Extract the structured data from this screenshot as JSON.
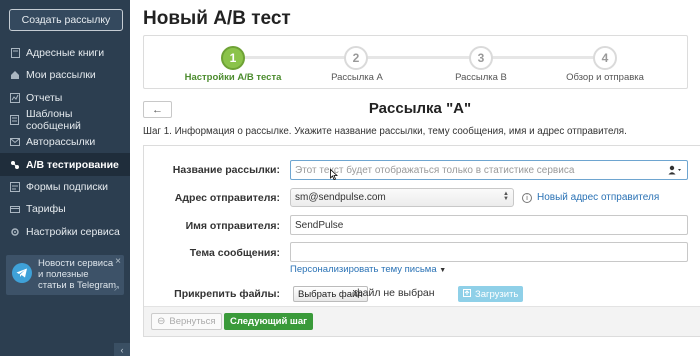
{
  "sidebar": {
    "create_button": "Создать рассылку",
    "items": [
      {
        "label": "Адресные книги",
        "icon": "book-icon"
      },
      {
        "label": "Мои рассылки",
        "icon": "mailings-icon"
      },
      {
        "label": "Отчеты",
        "icon": "reports-icon"
      },
      {
        "label": "Шаблоны сообщений",
        "icon": "templates-icon"
      },
      {
        "label": "Авторассылки",
        "icon": "autoresponder-icon"
      },
      {
        "label": "A/B тестирование",
        "icon": "ab-test-icon",
        "active": true
      },
      {
        "label": "Формы подписки",
        "icon": "forms-icon"
      },
      {
        "label": "Тарифы",
        "icon": "pricing-icon"
      },
      {
        "label": "Настройки сервиса",
        "icon": "settings-icon"
      }
    ],
    "telegram": {
      "text": "Новости сервиса и полезные статьи в Telegram",
      "close": "×"
    },
    "collapse": "‹"
  },
  "page": {
    "title": "Новый A/B тест"
  },
  "steps": [
    {
      "num": "1",
      "label": "Настройки A/B теста",
      "status": "done"
    },
    {
      "num": "2",
      "label": "Рассылка A",
      "status": "todo"
    },
    {
      "num": "3",
      "label": "Рассылка B",
      "status": "todo"
    },
    {
      "num": "4",
      "label": "Обзор и отправка",
      "status": "todo"
    }
  ],
  "section": {
    "back": "←",
    "title": "Рассылка \"A\"",
    "description": "Шаг 1. Информация о рассылке. Укажите название рассылки, тему сообщения, имя и адрес отправителя."
  },
  "form": {
    "campaign_name": {
      "label": "Название рассылки:",
      "placeholder": "Этот текст будет отображаться только в статистике сервиса"
    },
    "sender_address": {
      "label": "Адрес отправителя:",
      "value": "sm@sendpulse.com",
      "new_link": "Новый адрес отправителя"
    },
    "sender_name": {
      "label": "Имя отправителя:",
      "value": "SendPulse"
    },
    "subject": {
      "label": "Тема сообщения:",
      "value": "",
      "personalize_link": "Персонализировать тему письма"
    },
    "attach": {
      "label": "Прикрепить файлы:",
      "choose_button": "Выбрать файл",
      "status": "файл не выбран",
      "upload_button": "Загрузить"
    },
    "prev_button": "Вернуться",
    "next_button": "Следующий шаг"
  },
  "colors": {
    "sidebar_bg": "#2c3e50",
    "step_done": "#8bc34a",
    "next_button": "#3a9a3a",
    "link": "#2a72b5"
  }
}
